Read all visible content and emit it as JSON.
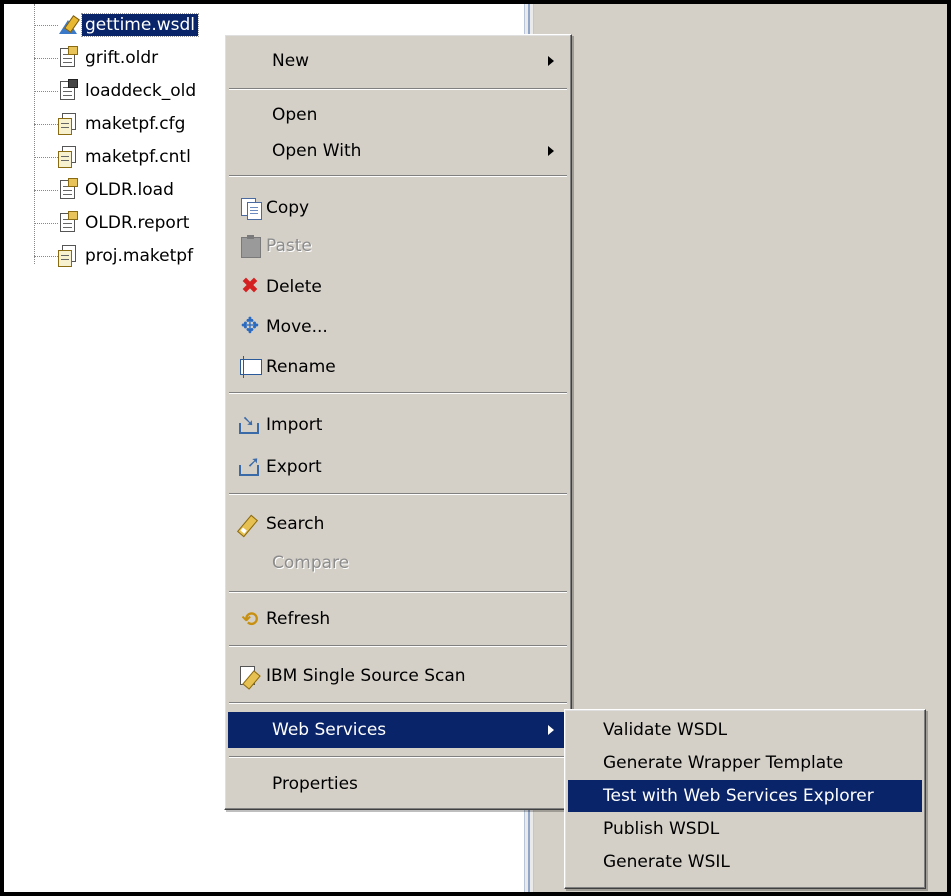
{
  "tree": {
    "items": [
      {
        "label": "gettime.wsdl",
        "icon": "wsdl-file-icon",
        "selected": true
      },
      {
        "label": "grift.oldr",
        "icon": "document-file-icon"
      },
      {
        "label": "loaddeck_old",
        "icon": "document-file-icon"
      },
      {
        "label": "maketpf.cfg",
        "icon": "config-file-icon"
      },
      {
        "label": "maketpf.cntl",
        "icon": "config-file-icon"
      },
      {
        "label": "OLDR.load",
        "icon": "document-file-icon"
      },
      {
        "label": "OLDR.report",
        "icon": "document-file-icon"
      },
      {
        "label": "proj.maketpf",
        "icon": "config-file-icon"
      }
    ]
  },
  "context_menu": {
    "new": "New",
    "open": "Open",
    "open_with": "Open With",
    "copy": "Copy",
    "paste": "Paste",
    "delete": "Delete",
    "move": "Move...",
    "rename": "Rename",
    "import": "Import",
    "export": "Export",
    "search": "Search",
    "compare": "Compare",
    "refresh": "Refresh",
    "ibm_scan": "IBM Single Source Scan",
    "web_services": "Web Services",
    "properties": "Properties"
  },
  "submenu": {
    "items": [
      {
        "label": "Validate WSDL"
      },
      {
        "label": "Generate Wrapper Template"
      },
      {
        "label": "Test with Web Services Explorer",
        "highlighted": true
      },
      {
        "label": "Publish WSDL"
      },
      {
        "label": "Generate WSIL"
      }
    ]
  },
  "colors": {
    "selection": "#0a246a",
    "menu_bg": "#d4d0c8",
    "disabled_text": "#8c8c8c"
  }
}
